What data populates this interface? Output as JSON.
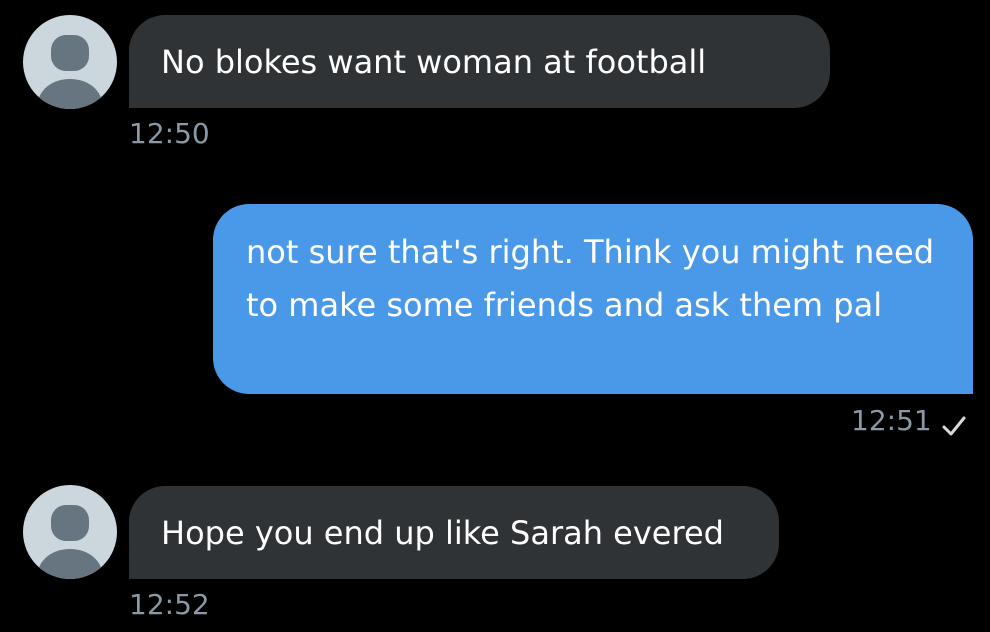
{
  "messages": [
    {
      "direction": "incoming",
      "text": "No blokes want woman at football",
      "time": "12:50"
    },
    {
      "direction": "outgoing",
      "text": "not sure that's right. Think you might need to make some friends and ask them pal",
      "time": "12:51",
      "status_icon": "checkmark-icon"
    },
    {
      "direction": "incoming",
      "text": "Hope you end up like Sarah evered",
      "time": "12:52"
    }
  ],
  "colors": {
    "background": "#000000",
    "incoming_bubble": "#2f3336",
    "outgoing_bubble": "#4a99e9",
    "timestamp": "#8b98a5",
    "avatar_bg": "#ccd6dd",
    "avatar_fg": "#66757f"
  }
}
